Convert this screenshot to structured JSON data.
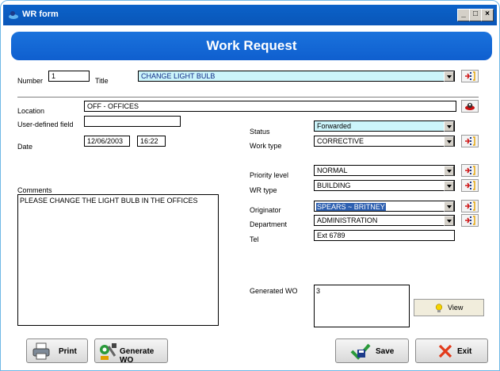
{
  "window": {
    "title": "WR form",
    "controls": [
      "_",
      "□",
      "×"
    ]
  },
  "banner": {
    "title": "Work Request"
  },
  "labels": {
    "number": "Number",
    "title": "Title",
    "location": "Location",
    "user_defined_field": "User-defined field",
    "date": "Date",
    "status": "Status",
    "work_type": "Work type",
    "priority_level": "Priority level",
    "wr_type": "WR type",
    "comments": "Comments",
    "originator": "Originator",
    "department": "Department",
    "tel": "Tel",
    "generated_wo": "Generated WO"
  },
  "fields": {
    "number": "1",
    "title": "CHANGE LIGHT BULB",
    "location": "OFF - OFFICES",
    "user_defined_field": "",
    "date": "12/06/2003",
    "time": "16:22",
    "status": "Forwarded",
    "work_type": "CORRECTIVE",
    "priority_level": "NORMAL",
    "wr_type": "BUILDING",
    "originator": "SPEARS ~ BRITNEY",
    "department": "ADMINISTRATION",
    "tel": "Ext 6789",
    "comments": "PLEASE CHANGE THE LIGHT BULB IN THE OFFICES",
    "generated_wo": "3"
  },
  "buttons": {
    "print": "Print",
    "generate_wo": "Generate WO",
    "save": "Save",
    "exit": "Exit",
    "view": "View"
  },
  "colors": {
    "title_bar": "#0b62c9",
    "banner": "#1a72dc",
    "highlight_field": "#ccf5fb",
    "selection": "#2d5fb0"
  },
  "icons": [
    "window-app-icon",
    "dropdown-arrow-icon",
    "lookup-list-icon",
    "location-browse-icon",
    "printer-icon",
    "generate-wo-icon",
    "save-icon",
    "exit-x-icon",
    "lightbulb-icon"
  ]
}
